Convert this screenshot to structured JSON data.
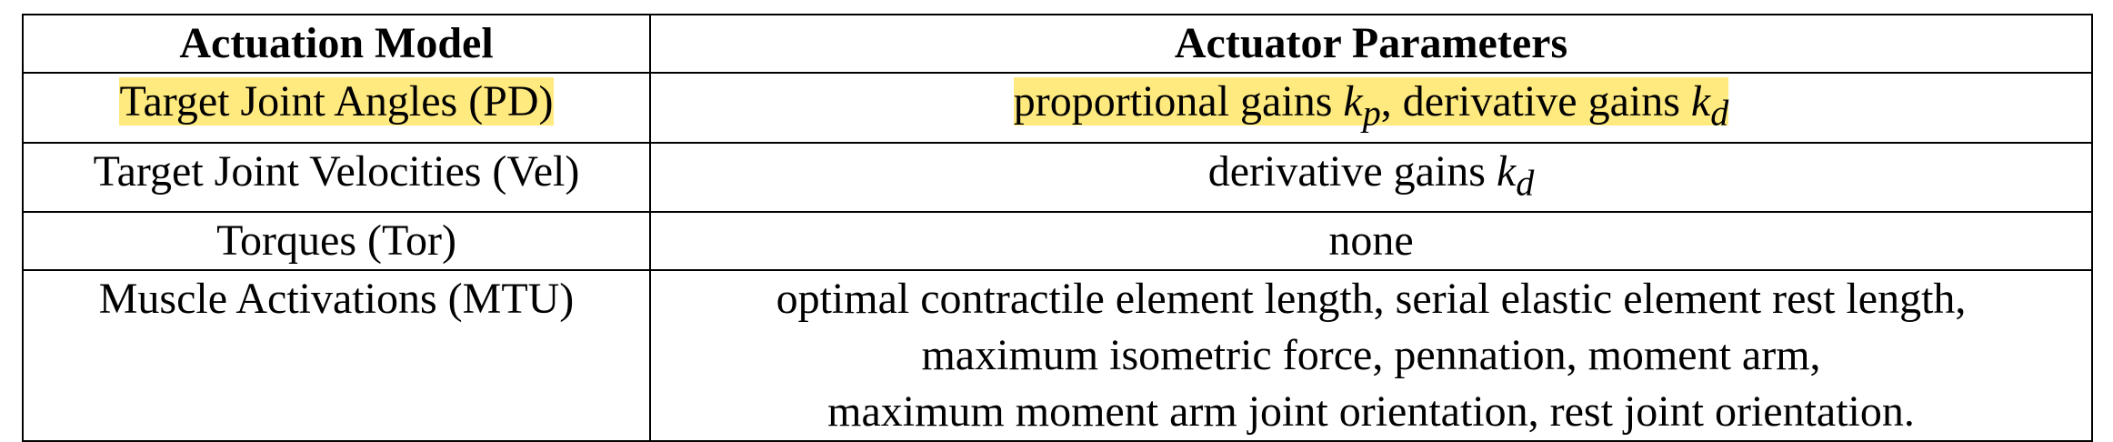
{
  "table": {
    "headers": [
      "Actuation Model",
      "Actuator Parameters"
    ],
    "rows": [
      {
        "model": "Target Joint Angles (PD)",
        "params_parts": [
          "proportional gains ",
          "k",
          "p",
          ", derivative gains ",
          "k",
          "d"
        ],
        "highlight": true
      },
      {
        "model": "Target Joint Velocities (Vel)",
        "params_parts": [
          "derivative gains ",
          "k",
          "d"
        ]
      },
      {
        "model": "Torques (Tor)",
        "params_lines": [
          "none"
        ]
      },
      {
        "model": "Muscle Activations (MTU)",
        "params_lines": [
          "optimal contractile element length, serial elastic element rest length,",
          "maximum isometric force, pennation, moment arm,",
          "maximum moment arm joint orientation, rest joint orientation."
        ]
      }
    ]
  },
  "colors": {
    "highlight": "#ffea7f",
    "border": "#000000"
  }
}
